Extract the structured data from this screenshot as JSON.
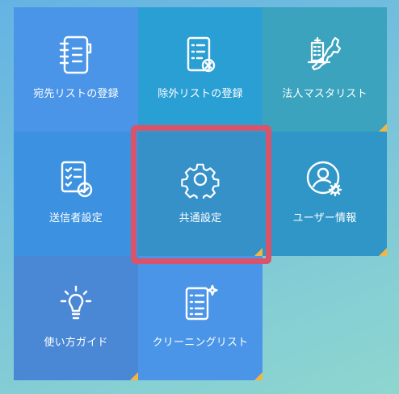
{
  "menu": {
    "tiles": [
      {
        "label": "宛先リストの登録",
        "icon": "address-book-icon",
        "color": "#4a95e8"
      },
      {
        "label": "除外リストの登録",
        "icon": "list-remove-icon",
        "color": "#2a9fd4"
      },
      {
        "label": "法人マスタリスト",
        "icon": "japan-map-building-icon",
        "color": "#3ba3be"
      },
      {
        "label": "送信者設定",
        "icon": "checklist-icon",
        "color": "#3c92e0"
      },
      {
        "label": "共通設定",
        "icon": "gear-icon",
        "color": "#3691c9"
      },
      {
        "label": "ユーザー情報",
        "icon": "user-settings-icon",
        "color": "#3096c7"
      },
      {
        "label": "使い方ガイド",
        "icon": "lightbulb-icon",
        "color": "#4a88d6"
      },
      {
        "label": "クリーニングリスト",
        "icon": "list-sparkle-icon",
        "color": "#4a95e8"
      }
    ]
  },
  "selection": {
    "highlight_color": "#d9546a",
    "corner_color": "#f4b63f"
  }
}
